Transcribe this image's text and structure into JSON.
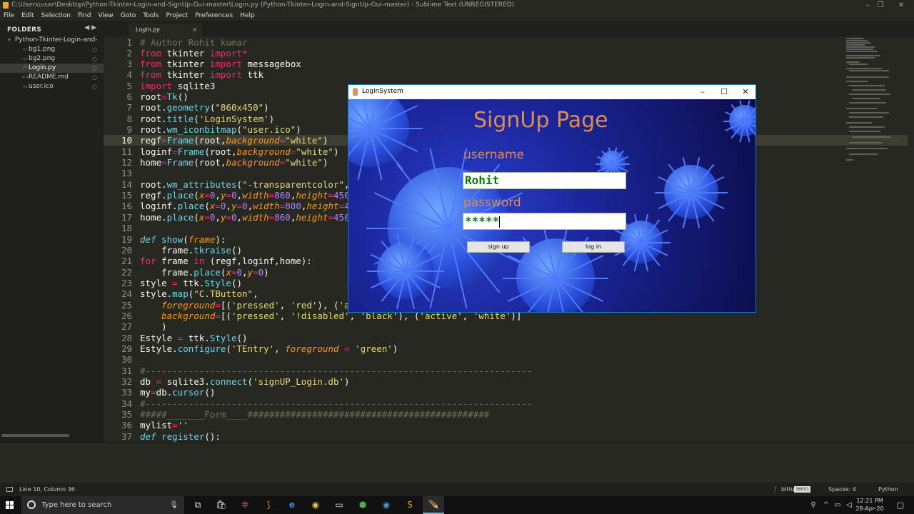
{
  "window": {
    "title": "C:\\Users\\user\\Desktop\\Python-Tkinter-Login-and-SignUp-Gui-master\\Login.py (Python-Tkinter-Login-and-SignUp-Gui-master) - Sublime Text (UNREGISTERED)"
  },
  "menu": [
    "File",
    "Edit",
    "Selection",
    "Find",
    "View",
    "Goto",
    "Tools",
    "Project",
    "Preferences",
    "Help"
  ],
  "sidebar": {
    "header": "FOLDERS",
    "arrows": "◀ ▶",
    "folder": "Python-Tkinter-Login-and-",
    "files": [
      {
        "name": "bg1.png",
        "icon": "image-file-icon"
      },
      {
        "name": "bg2.png",
        "icon": "image-file-icon"
      },
      {
        "name": "Login.py",
        "icon": "code-file-icon",
        "selected": true
      },
      {
        "name": "README.md",
        "icon": "code-file-icon"
      },
      {
        "name": "user.ico",
        "icon": "image-file-icon"
      }
    ]
  },
  "tab": {
    "label": "Login.py",
    "close": "×"
  },
  "editor": {
    "current_line": 10,
    "line_numbers": [
      "1",
      "2",
      "3",
      "4",
      "5",
      "6",
      "7",
      "8",
      "9",
      "10",
      "11",
      "12",
      "13",
      "14",
      "15",
      "16",
      "17",
      "18",
      "19",
      "20",
      "21",
      "22",
      "23",
      "24",
      "25",
      "26",
      "27",
      "28",
      "29",
      "30",
      "31",
      "32",
      "33",
      "34",
      "35",
      "36",
      "37"
    ]
  },
  "login_window": {
    "title": "LoginSystem",
    "heading": "SignUp Page",
    "username_label": "username",
    "username_value": "Rohit",
    "password_label": "password",
    "password_value": "*****",
    "signup_button": "sign up",
    "login_button": "log in"
  },
  "status": {
    "position": "Line 10, Column 36",
    "branch": "bittu",
    "badge": "38051",
    "spaces": "Spaces: 4",
    "syntax": "Python"
  },
  "taskbar": {
    "search_placeholder": "Type here to search",
    "time": "12:21 PM",
    "date": "28-Apr-20"
  },
  "colors": {
    "accent_orange": "#e28a52",
    "entry_green": "#0a7d0a",
    "editor_bg": "#272822"
  }
}
